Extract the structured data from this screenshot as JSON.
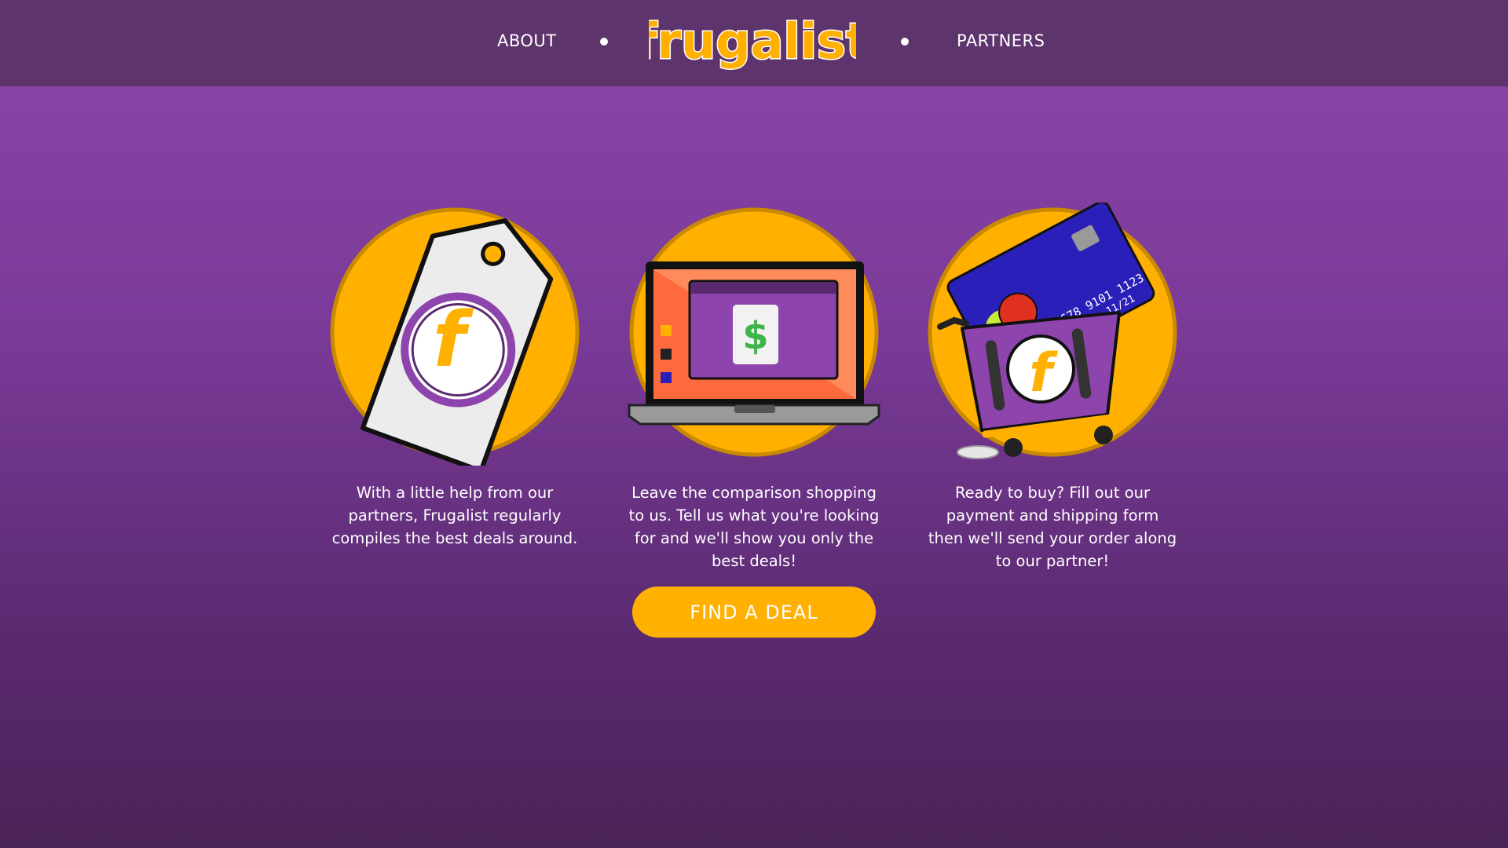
{
  "nav": {
    "about_label": "ABOUT",
    "partners_label": "PARTNERS",
    "logo_text": "frugalist"
  },
  "features": [
    {
      "icon": "price-tag-icon",
      "text": "With a little help from our partners, Frugalist regularly compiles the best deals around."
    },
    {
      "icon": "laptop-icon",
      "text": "Leave the comparison shopping to us. Tell us what you're looking for and we'll show you only the best deals!"
    },
    {
      "icon": "credit-card-cart-icon",
      "text": "Ready to buy? Fill out our payment and shipping form then we'll send your order along to our partner!"
    }
  ],
  "cta": {
    "label": "FIND A DEAL"
  },
  "card": {
    "number": "5678 9101 1123",
    "expiry": "11/21"
  },
  "laptop_symbol": "$",
  "brand_letter": "f",
  "colors": {
    "header": "#5e346c",
    "accent": "#ffb000",
    "purple": "#8e44ad",
    "card_blue": "#2a1fb8"
  }
}
